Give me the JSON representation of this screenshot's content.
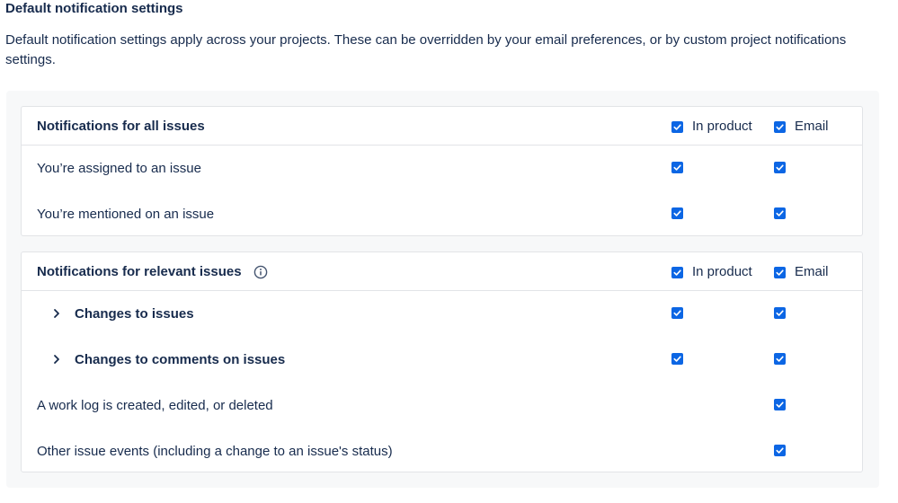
{
  "page": {
    "title": "Default notification settings",
    "description": "Default notification settings apply across your projects. These can be overridden by your email preferences, or by custom project notifications settings."
  },
  "columns": {
    "in_product": "In product",
    "email": "Email"
  },
  "all_issues": {
    "title": "Notifications for all issues",
    "rows": [
      {
        "label": "You’re assigned to an issue",
        "in_product": true,
        "email": true
      },
      {
        "label": "You’re mentioned on an issue",
        "in_product": true,
        "email": true
      }
    ]
  },
  "relevant_issues": {
    "title": "Notifications for relevant issues",
    "info_icon": "info-icon",
    "rows": [
      {
        "label": "Changes to issues",
        "expandable": true,
        "in_product": true,
        "email": true
      },
      {
        "label": "Changes to comments on issues",
        "expandable": true,
        "in_product": true,
        "email": true
      },
      {
        "label": "A work log is created, edited, or deleted",
        "expandable": false,
        "in_product": false,
        "email": true
      },
      {
        "label": "Other issue events (including a change to an issue's status)",
        "expandable": false,
        "in_product": false,
        "email": true
      }
    ]
  },
  "colors": {
    "checkbox": "#0c66e4",
    "text": "#172b4d",
    "border": "#e2e4e7",
    "panel_bg": "#f7f8f9"
  },
  "icons": {
    "checkbox_checked": "check-icon",
    "expand": "chevron-right-icon"
  }
}
